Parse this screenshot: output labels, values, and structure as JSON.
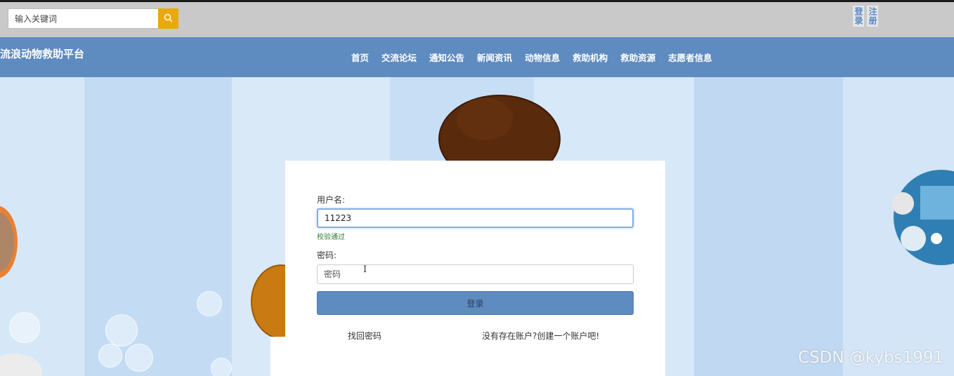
{
  "search": {
    "placeholder": "输入关键词"
  },
  "auth": {
    "login": "登录",
    "register": "注册"
  },
  "brand": {
    "title": "流浪动物救助平台"
  },
  "nav": [
    "首页",
    "交流论坛",
    "通知公告",
    "新闻资讯",
    "动物信息",
    "救助机构",
    "救助资源",
    "志愿者信息"
  ],
  "form": {
    "username_label": "用户名:",
    "username_value": "11223",
    "validation_message": "校验通过",
    "password_label": "密码:",
    "password_placeholder": "密码",
    "login_button": "登录",
    "forgot_link": "找回密码",
    "register_link": "没有存在账户?创建一个账户吧!"
  },
  "watermark": "CSDN @kybs1991",
  "colors": {
    "topbar": "#c9c9c9",
    "navbar": "#5e8bc0",
    "search_button": "#e9a90a",
    "valid": "#2f7d32"
  },
  "icons": [
    "search-icon",
    "text-cursor-icon"
  ]
}
